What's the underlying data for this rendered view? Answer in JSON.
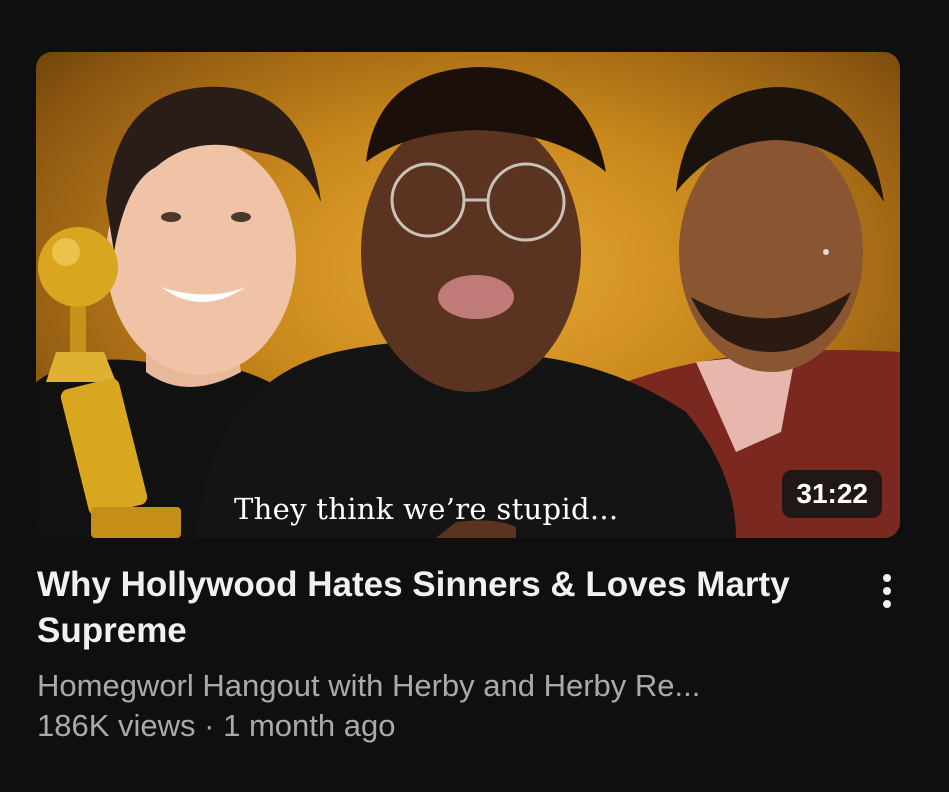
{
  "video": {
    "caption": "They think we’re stupid...",
    "duration": "31:22",
    "title": "Why Hollywood Hates Sinners & Loves Marty Supreme",
    "channel": "Homegworl Hangout with Herby and Herby Re...",
    "views": "186K views",
    "separator": "·",
    "age": "1 month ago"
  },
  "icons": {
    "more": "more-vert-icon",
    "trophy": "golden-globe-trophy-icon"
  },
  "colors": {
    "background": "#0f0f0f",
    "title": "#f1f1f1",
    "meta": "#aaaaaa",
    "thumbnail_backdrop": "#d79a26"
  }
}
